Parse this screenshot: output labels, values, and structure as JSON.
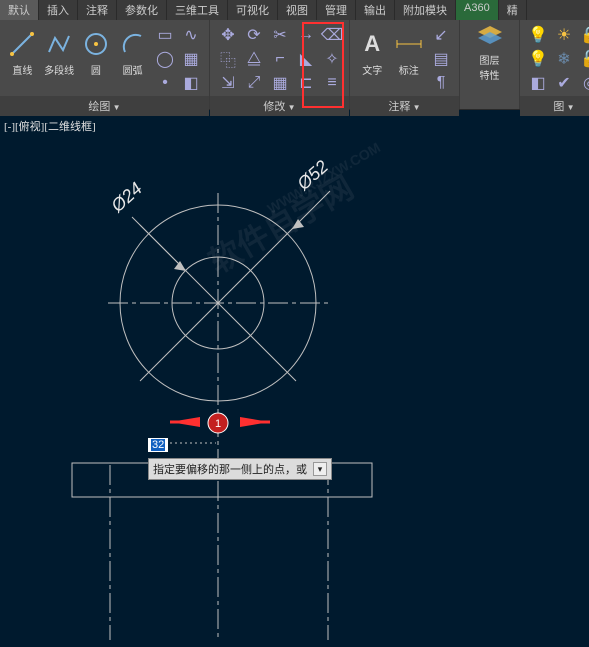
{
  "tabs": [
    "默认",
    "插入",
    "注释",
    "参数化",
    "三维工具",
    "可视化",
    "视图",
    "管理",
    "输出",
    "附加模块",
    "A360",
    "精"
  ],
  "activeTab": 0,
  "panels": {
    "draw": {
      "title": "绘图",
      "buttons": {
        "line": "直线",
        "polyline": "多段线",
        "circle": "圆",
        "arc": "圆弧"
      }
    },
    "modify": {
      "title": "修改"
    },
    "annotate": {
      "title": "注释",
      "buttons": {
        "text": "文字",
        "dim": "标注"
      }
    },
    "layer": {
      "title": "图",
      "buttons": {
        "layerprops": "图层\n特性"
      }
    }
  },
  "viewport_tag": "[-][俯视][二维线框]",
  "drawing": {
    "d_outer": "Ø52",
    "d_inner": "Ø24",
    "offset_input": "32",
    "tooltip": "指定要偏移的那一侧上的点，或",
    "marker": "1"
  },
  "watermark": "软件自学网",
  "watermark_url": "WWW.RJZXW.COM",
  "chart_data": {
    "type": "diagram",
    "note": "CAD drawing: two concentric circles Ø24 and Ø52 with centerlines, rectangular base below, offset command active with distance 32"
  }
}
